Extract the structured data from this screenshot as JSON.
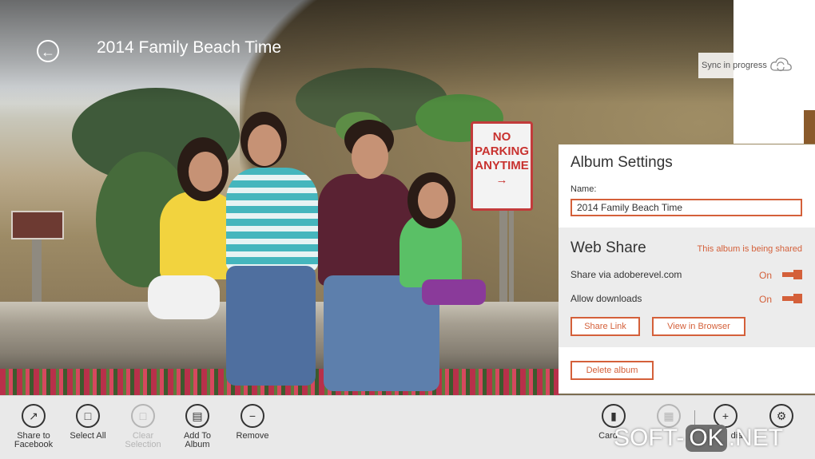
{
  "header": {
    "album_title": "2014 Family Beach Time",
    "back_icon": "back-arrow-icon"
  },
  "photo": {
    "sign_line1": "NO",
    "sign_line2": "PARKING",
    "sign_line3": "ANYTIME",
    "sign_arrow": "→"
  },
  "sync": {
    "status_text": "Sync in progress",
    "icon": "cloud-sync-icon"
  },
  "album_settings": {
    "title": "Album Settings",
    "name_label": "Name:",
    "name_value": "2014 Family Beach Time",
    "web_share": {
      "title": "Web Share",
      "status": "This album is being shared",
      "share_via_label": "Share via adoberevel.com",
      "share_via_state": "On",
      "allow_downloads_label": "Allow downloads",
      "allow_downloads_state": "On",
      "share_link_label": "Share Link",
      "view_in_browser_label": "View in Browser"
    },
    "delete_album_label": "Delete album"
  },
  "appbar": {
    "left_items": [
      {
        "label": "Share to Facebook",
        "line1": "Share to",
        "line2": "Facebook",
        "icon": "share-icon",
        "enabled": true
      },
      {
        "label": "Select All",
        "icon": "select-all-icon",
        "enabled": true
      },
      {
        "label": "Clear Selection",
        "line1": "Clear",
        "line2": "Selection",
        "icon": "clear-selection-icon",
        "enabled": false
      },
      {
        "label": "Add To Album",
        "line1": "Add To",
        "line2": "Album",
        "icon": "add-to-album-icon",
        "enabled": true
      },
      {
        "label": "Remove",
        "icon": "remove-icon",
        "enabled": true
      }
    ],
    "right_items": [
      {
        "label": "Card",
        "icon": "card-view-icon",
        "enabled": true
      },
      {
        "label": "",
        "icon": "grid-view-icon",
        "enabled": false
      },
      {
        "label": "dia",
        "icon": "add-media-icon",
        "enabled": true
      },
      {
        "label": "",
        "icon": "settings-gear-icon",
        "enabled": true
      }
    ]
  },
  "watermark": {
    "part1": "SOFT-",
    "part2": "OK",
    "part3": ".NET"
  },
  "colors": {
    "accent": "#d4603a",
    "appbar_bg": "#e9e9e9",
    "panel_bg": "#ffffff",
    "panel_section_bg": "#ececec"
  }
}
